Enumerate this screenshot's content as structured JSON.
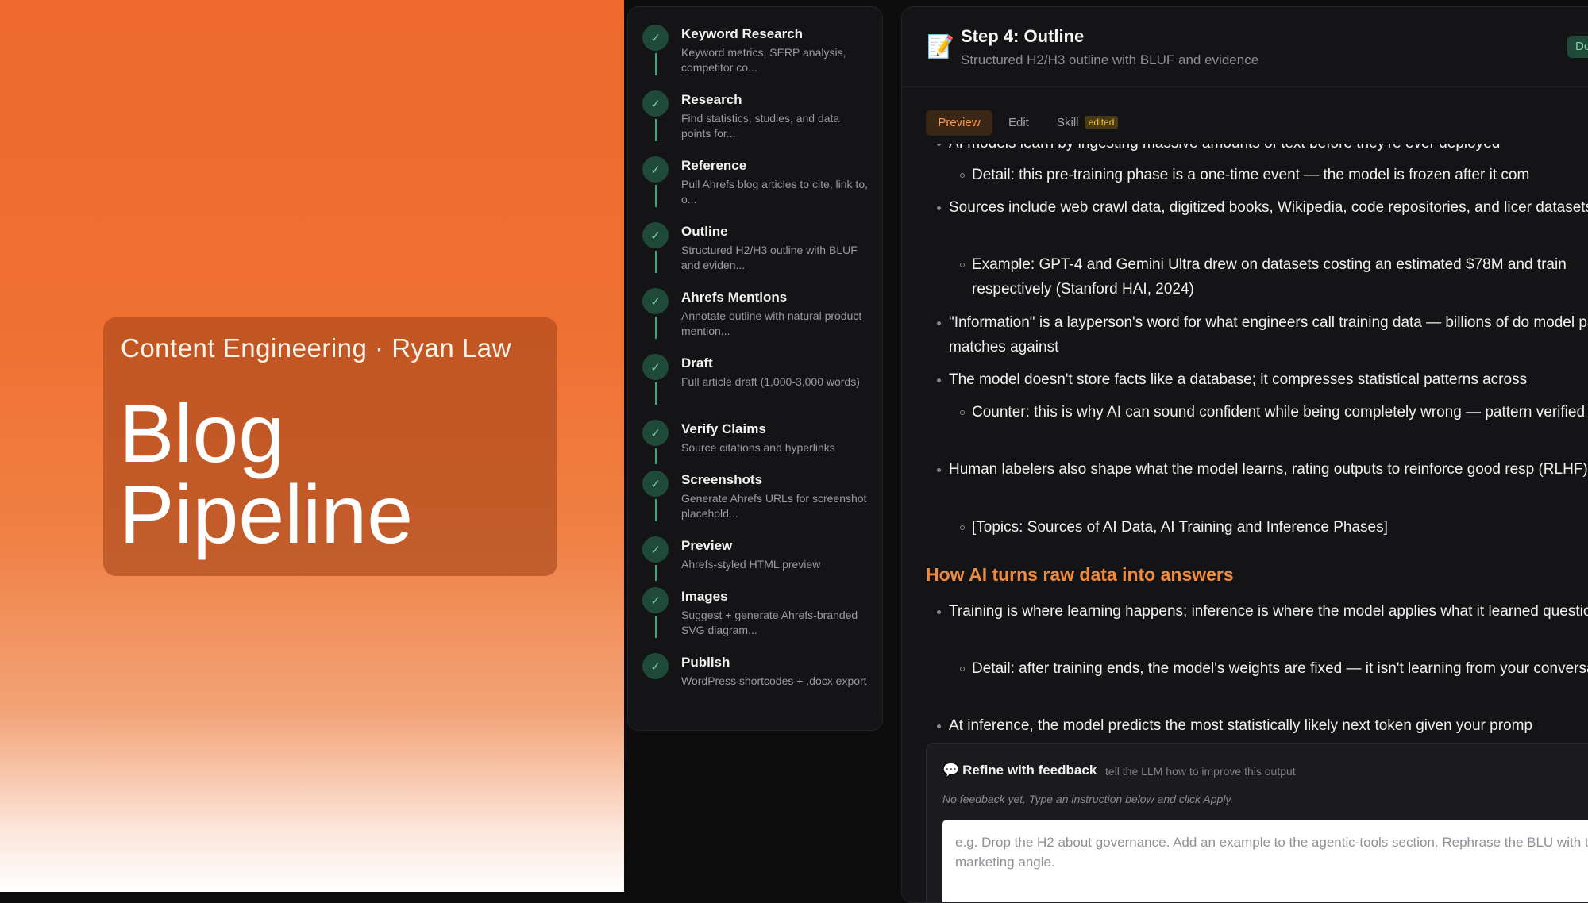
{
  "hero": {
    "subtitle": "Content Engineering · Ryan Law",
    "title_line1": "Blog",
    "title_line2": "Pipeline",
    "accent_color": "#ee6a2e"
  },
  "steps": [
    {
      "title": "Keyword Research",
      "desc": "Keyword metrics, SERP analysis, competitor co..."
    },
    {
      "title": "Research",
      "desc": "Find statistics, studies, and data points for..."
    },
    {
      "title": "Reference",
      "desc": "Pull Ahrefs blog articles to cite, link to, o..."
    },
    {
      "title": "Outline",
      "desc": "Structured H2/H3 outline with BLUF and eviden..."
    },
    {
      "title": "Ahrefs Mentions",
      "desc": "Annotate outline with natural product mention..."
    },
    {
      "title": "Draft",
      "desc": "Full article draft (1,000-3,000 words)"
    },
    {
      "title": "Verify Claims",
      "desc": "Source citations and hyperlinks"
    },
    {
      "title": "Screenshots",
      "desc": "Generate Ahrefs URLs for screenshot placehold..."
    },
    {
      "title": "Preview",
      "desc": "Ahrefs-styled HTML preview"
    },
    {
      "title": "Images",
      "desc": "Suggest + generate Ahrefs-branded SVG diagram..."
    },
    {
      "title": "Publish",
      "desc": "WordPress shortcodes + .docx export"
    }
  ],
  "step_header": {
    "icon": "memo-icon",
    "title": "Step 4: Outline",
    "subtitle": "Structured H2/H3 outline with BLUF and evidence",
    "done_label": "Do"
  },
  "tabs": {
    "preview": "Preview",
    "edit": "Edit",
    "skill": "Skill",
    "skill_badge": "edited"
  },
  "content": {
    "b1": "AI models learn by ingesting massive amounts of text before they're ever deployed",
    "s1": "Detail: this pre-training phase is a one-time event — the model is frozen after it com",
    "b2": "Sources include web crawl data, digitized books, Wikipedia, code repositories, and licer datasets",
    "s2": "Example: GPT-4 and Gemini Ultra drew on datasets costing an estimated $78M and train respectively (Stanford HAI, 2024)",
    "b3": "\"Information\" is a layperson's word for what engineers call training data — billions of do model pattern-matches against",
    "b4": "The model doesn't store facts like a database; it compresses statistical patterns across",
    "s4": "Counter: this is why AI can sound confident while being completely wrong — pattern verified fact",
    "b5": "Human labelers also shape what the model learns, rating outputs to reinforce good resp (RLHF)",
    "s5": "[Topics: Sources of AI Data, AI Training and Inference Phases]",
    "h2": "How AI turns raw data into answers",
    "b6": "Training is where learning happens; inference is where the model applies what it learned question",
    "s6": "Detail: after training ends, the model's weights are fixed — it isn't learning from your conversation",
    "b7": "At inference, the model predicts the most statistically likely next token given your promp"
  },
  "feedback": {
    "title": "Refine with feedback",
    "hint": "tell the LLM how to improve this output",
    "empty": "No feedback yet. Type an instruction below and click Apply.",
    "placeholder": "e.g. Drop the H2 about governance. Add an example to the agentic-tools section. Rephrase the BLU with the marketing angle."
  }
}
